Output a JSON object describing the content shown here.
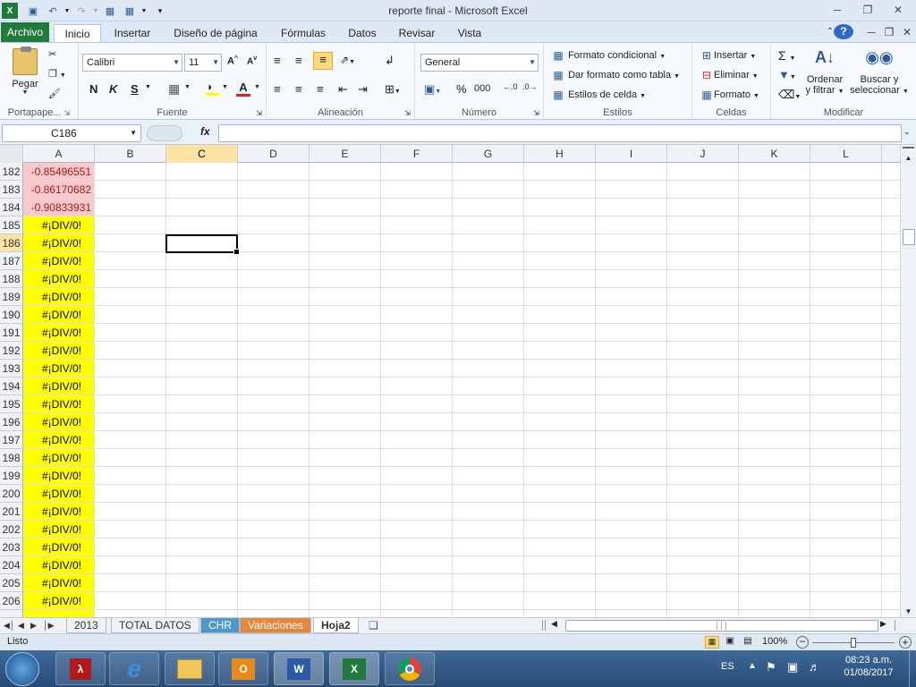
{
  "app": {
    "title": "reporte final  -  Microsoft Excel"
  },
  "ribbon_tabs": [
    "Archivo",
    "Inicio",
    "Insertar",
    "Diseño de página",
    "Fórmulas",
    "Datos",
    "Revisar",
    "Vista"
  ],
  "ribbon": {
    "clipboard": {
      "paste": "Pegar",
      "label": "Portapape..."
    },
    "font": {
      "name": "Calibri",
      "size": "11",
      "bold": "N",
      "italic": "K",
      "underline": "S",
      "label": "Fuente"
    },
    "alignment": {
      "label": "Alineación"
    },
    "number": {
      "format": "General",
      "percent": "%",
      "thousands": "000",
      "label": "Número"
    },
    "styles": {
      "conditional": "Formato condicional",
      "table": "Dar formato como tabla",
      "cell_styles": "Estilos de celda",
      "label": "Estilos"
    },
    "cells": {
      "insert": "Insertar",
      "delete": "Eliminar",
      "format": "Formato",
      "label": "Celdas"
    },
    "editing": {
      "sum": "Σ",
      "sort": "Ordenar",
      "sort2": "y filtrar",
      "find": "Buscar y",
      "find2": "seleccionar",
      "label": "Modificar"
    }
  },
  "formula_bar": {
    "name_box": "C186",
    "fx": "fx",
    "formula": ""
  },
  "columns": [
    "A",
    "B",
    "C",
    "D",
    "E",
    "F",
    "G",
    "H",
    "I",
    "J",
    "K",
    "L"
  ],
  "selected_column": "C",
  "selected_row": "186",
  "rows": [
    {
      "n": "182",
      "a": "-0.85496551",
      "style": "neg"
    },
    {
      "n": "183",
      "a": "-0.86170682",
      "style": "neg"
    },
    {
      "n": "184",
      "a": "-0.90833931",
      "style": "neg"
    },
    {
      "n": "185",
      "a": "#¡DIV/0!",
      "style": "err"
    },
    {
      "n": "186",
      "a": "#¡DIV/0!",
      "style": "err"
    },
    {
      "n": "187",
      "a": "#¡DIV/0!",
      "style": "err"
    },
    {
      "n": "188",
      "a": "#¡DIV/0!",
      "style": "err"
    },
    {
      "n": "189",
      "a": "#¡DIV/0!",
      "style": "err"
    },
    {
      "n": "190",
      "a": "#¡DIV/0!",
      "style": "err"
    },
    {
      "n": "191",
      "a": "#¡DIV/0!",
      "style": "err"
    },
    {
      "n": "192",
      "a": "#¡DIV/0!",
      "style": "err"
    },
    {
      "n": "193",
      "a": "#¡DIV/0!",
      "style": "err"
    },
    {
      "n": "194",
      "a": "#¡DIV/0!",
      "style": "err"
    },
    {
      "n": "195",
      "a": "#¡DIV/0!",
      "style": "err"
    },
    {
      "n": "196",
      "a": "#¡DIV/0!",
      "style": "err"
    },
    {
      "n": "197",
      "a": "#¡DIV/0!",
      "style": "err"
    },
    {
      "n": "198",
      "a": "#¡DIV/0!",
      "style": "err"
    },
    {
      "n": "199",
      "a": "#¡DIV/0!",
      "style": "err"
    },
    {
      "n": "200",
      "a": "#¡DIV/0!",
      "style": "err"
    },
    {
      "n": "201",
      "a": "#¡DIV/0!",
      "style": "err"
    },
    {
      "n": "202",
      "a": "#¡DIV/0!",
      "style": "err"
    },
    {
      "n": "203",
      "a": "#¡DIV/0!",
      "style": "err"
    },
    {
      "n": "204",
      "a": "#¡DIV/0!",
      "style": "err"
    },
    {
      "n": "205",
      "a": "#¡DIV/0!",
      "style": "err"
    },
    {
      "n": "206",
      "a": "#¡DIV/0!",
      "style": "err"
    }
  ],
  "sheet_tabs": [
    {
      "label": "2013",
      "color": "#eef1f5"
    },
    {
      "label": "TOTAL DATOS",
      "color": "#eef1f5"
    },
    {
      "label": "CHR",
      "color": "#4a9bc9"
    },
    {
      "label": "Variaciones",
      "color": "#e8873a"
    },
    {
      "label": "Hoja2",
      "color": "#ffffff",
      "active": true
    }
  ],
  "status": {
    "text": "Listo",
    "zoom": "100%"
  },
  "taskbar": {
    "lang": "ES",
    "time": "08:23 a.m.",
    "date": "01/08/2017"
  },
  "colors": {
    "neg_fill": "#fbc8cc",
    "neg_text": "#9c1c1c",
    "err_fill": "#ffff00",
    "excel_green": "#1f7a3c",
    "selected_header": "#fde3a4"
  }
}
